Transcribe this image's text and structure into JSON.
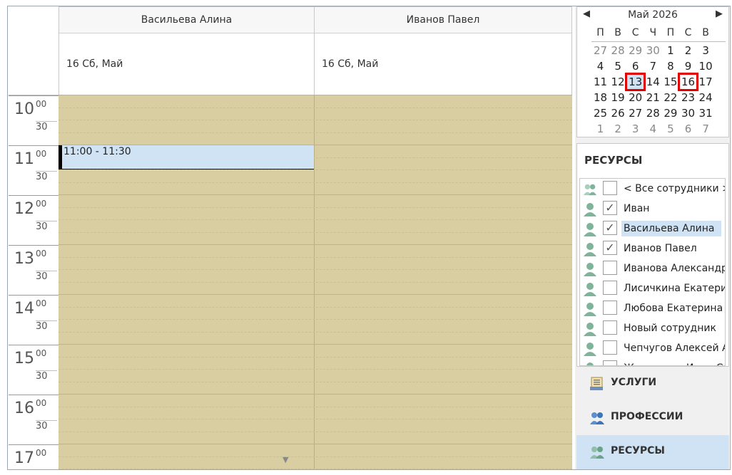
{
  "scheduler": {
    "columns": [
      {
        "name": "Васильева Алина",
        "date": "16 Сб, Май"
      },
      {
        "name": "Иванов Павел",
        "date": "16 Сб, Май"
      }
    ],
    "hours": [
      {
        "h": "10",
        "m": "00",
        "half": "30"
      },
      {
        "h": "11",
        "m": "00",
        "half": "30"
      },
      {
        "h": "12",
        "m": "00",
        "half": "30"
      },
      {
        "h": "13",
        "m": "00",
        "half": "30"
      },
      {
        "h": "14",
        "m": "00",
        "half": "30"
      },
      {
        "h": "15",
        "m": "00",
        "half": "30"
      },
      {
        "h": "16",
        "m": "00",
        "half": "30"
      },
      {
        "h": "17",
        "m": "00",
        "half": ""
      }
    ],
    "appointment": {
      "text": "11:00 - 11:30"
    },
    "scroll_glyph": "▼"
  },
  "calendar": {
    "prev": "◀",
    "next": "▶",
    "month_label": "Май 2026",
    "weekdays": [
      "П",
      "В",
      "С",
      "Ч",
      "П",
      "С",
      "В"
    ],
    "weeks": [
      [
        "27",
        "28",
        "29",
        "30",
        "1",
        "2",
        "3"
      ],
      [
        "4",
        "5",
        "6",
        "7",
        "8",
        "9",
        "10"
      ],
      [
        "11",
        "12",
        "13",
        "14",
        "15",
        "16",
        "17"
      ],
      [
        "18",
        "19",
        "20",
        "21",
        "22",
        "23",
        "24"
      ],
      [
        "25",
        "26",
        "27",
        "28",
        "29",
        "30",
        "31"
      ],
      [
        "1",
        "2",
        "3",
        "4",
        "5",
        "6",
        "7"
      ]
    ],
    "other_month": [
      [
        0,
        0
      ],
      [
        0,
        1
      ],
      [
        0,
        2
      ],
      [
        0,
        3
      ],
      [
        5,
        0
      ],
      [
        5,
        1
      ],
      [
        5,
        2
      ],
      [
        5,
        3
      ],
      [
        5,
        4
      ],
      [
        5,
        5
      ],
      [
        5,
        6
      ]
    ],
    "selected": [
      [
        2,
        2
      ]
    ],
    "marked": [
      [
        2,
        2
      ],
      [
        2,
        5
      ]
    ]
  },
  "resources": {
    "title": "РЕСУРСЫ",
    "items": [
      {
        "label": "< Все сотрудники >",
        "checked": false,
        "group": true,
        "highlight": false
      },
      {
        "label": "Иван",
        "checked": true,
        "group": false,
        "highlight": false
      },
      {
        "label": "Васильева Алина",
        "checked": true,
        "group": false,
        "highlight": true
      },
      {
        "label": "Иванов Павел",
        "checked": true,
        "group": false,
        "highlight": false
      },
      {
        "label": "Иванова Александра",
        "checked": false,
        "group": false,
        "highlight": false
      },
      {
        "label": "Лисичкина Екатерина",
        "checked": false,
        "group": false,
        "highlight": false
      },
      {
        "label": "Любова Екатерина",
        "checked": false,
        "group": false,
        "highlight": false
      },
      {
        "label": "Новый сотрудник",
        "checked": false,
        "group": false,
        "highlight": false
      },
      {
        "label": "Чепчугов Алексей А",
        "checked": false,
        "group": false,
        "highlight": false
      },
      {
        "label": "Журавлева Инна Се",
        "checked": false,
        "group": false,
        "highlight": false
      }
    ],
    "check_glyph": "✓"
  },
  "accordion": {
    "services": "УСЛУГИ",
    "professions": "ПРОФЕССИИ",
    "resources": "РЕСУРСЫ"
  },
  "colors": {
    "grid": "#d9cea1",
    "appointment": "#cfe3f5",
    "highlight": "#cfe3f5",
    "marker": "#e00000",
    "person_icon": "#7fb39a"
  }
}
